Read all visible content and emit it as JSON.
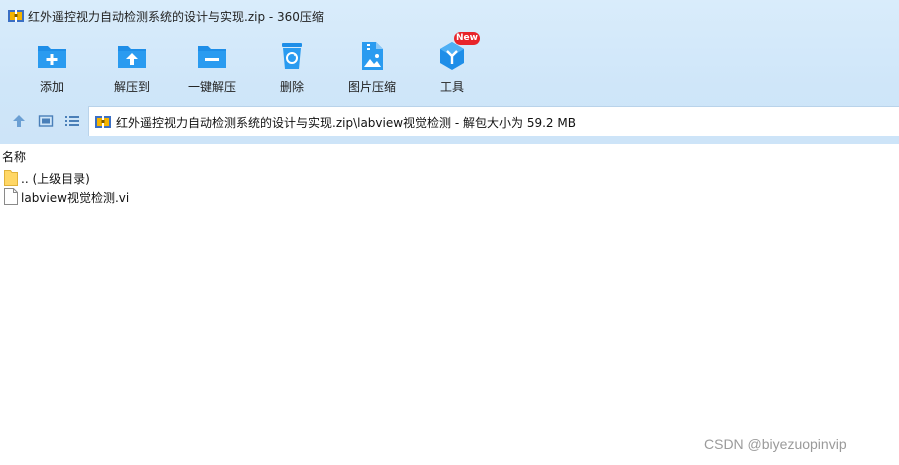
{
  "window": {
    "title": "红外遥控视力自动检测系统的设计与实现.zip - 360压缩"
  },
  "toolbar": {
    "items": [
      {
        "label": "添加",
        "icon": "add-folder-icon"
      },
      {
        "label": "解压到",
        "icon": "extract-to-folder-icon"
      },
      {
        "label": "一键解压",
        "icon": "one-click-extract-icon"
      },
      {
        "label": "删除",
        "icon": "recycle-bin-icon"
      },
      {
        "label": "图片压缩",
        "icon": "image-compress-icon"
      },
      {
        "label": "工具",
        "icon": "tools-cube-icon"
      }
    ],
    "new_badge": "New"
  },
  "navbar": {
    "path": "红外遥控视力自动检测系统的设计与实现.zip\\labview视觉检测 - 解包大小为 59.2 MB"
  },
  "filelist": {
    "column_name": "名称",
    "rows": [
      {
        "name": ".. (上级目录)",
        "icon": "folder-icon"
      },
      {
        "name": "labview视觉检测.vi",
        "icon": "file-icon"
      }
    ]
  },
  "watermark": "CSDN @biyezuopinvip",
  "colors": {
    "toolbar_bg": "#cfe6f9",
    "icon_blue": "#1e8ee8",
    "badge_red": "#e8242a"
  }
}
